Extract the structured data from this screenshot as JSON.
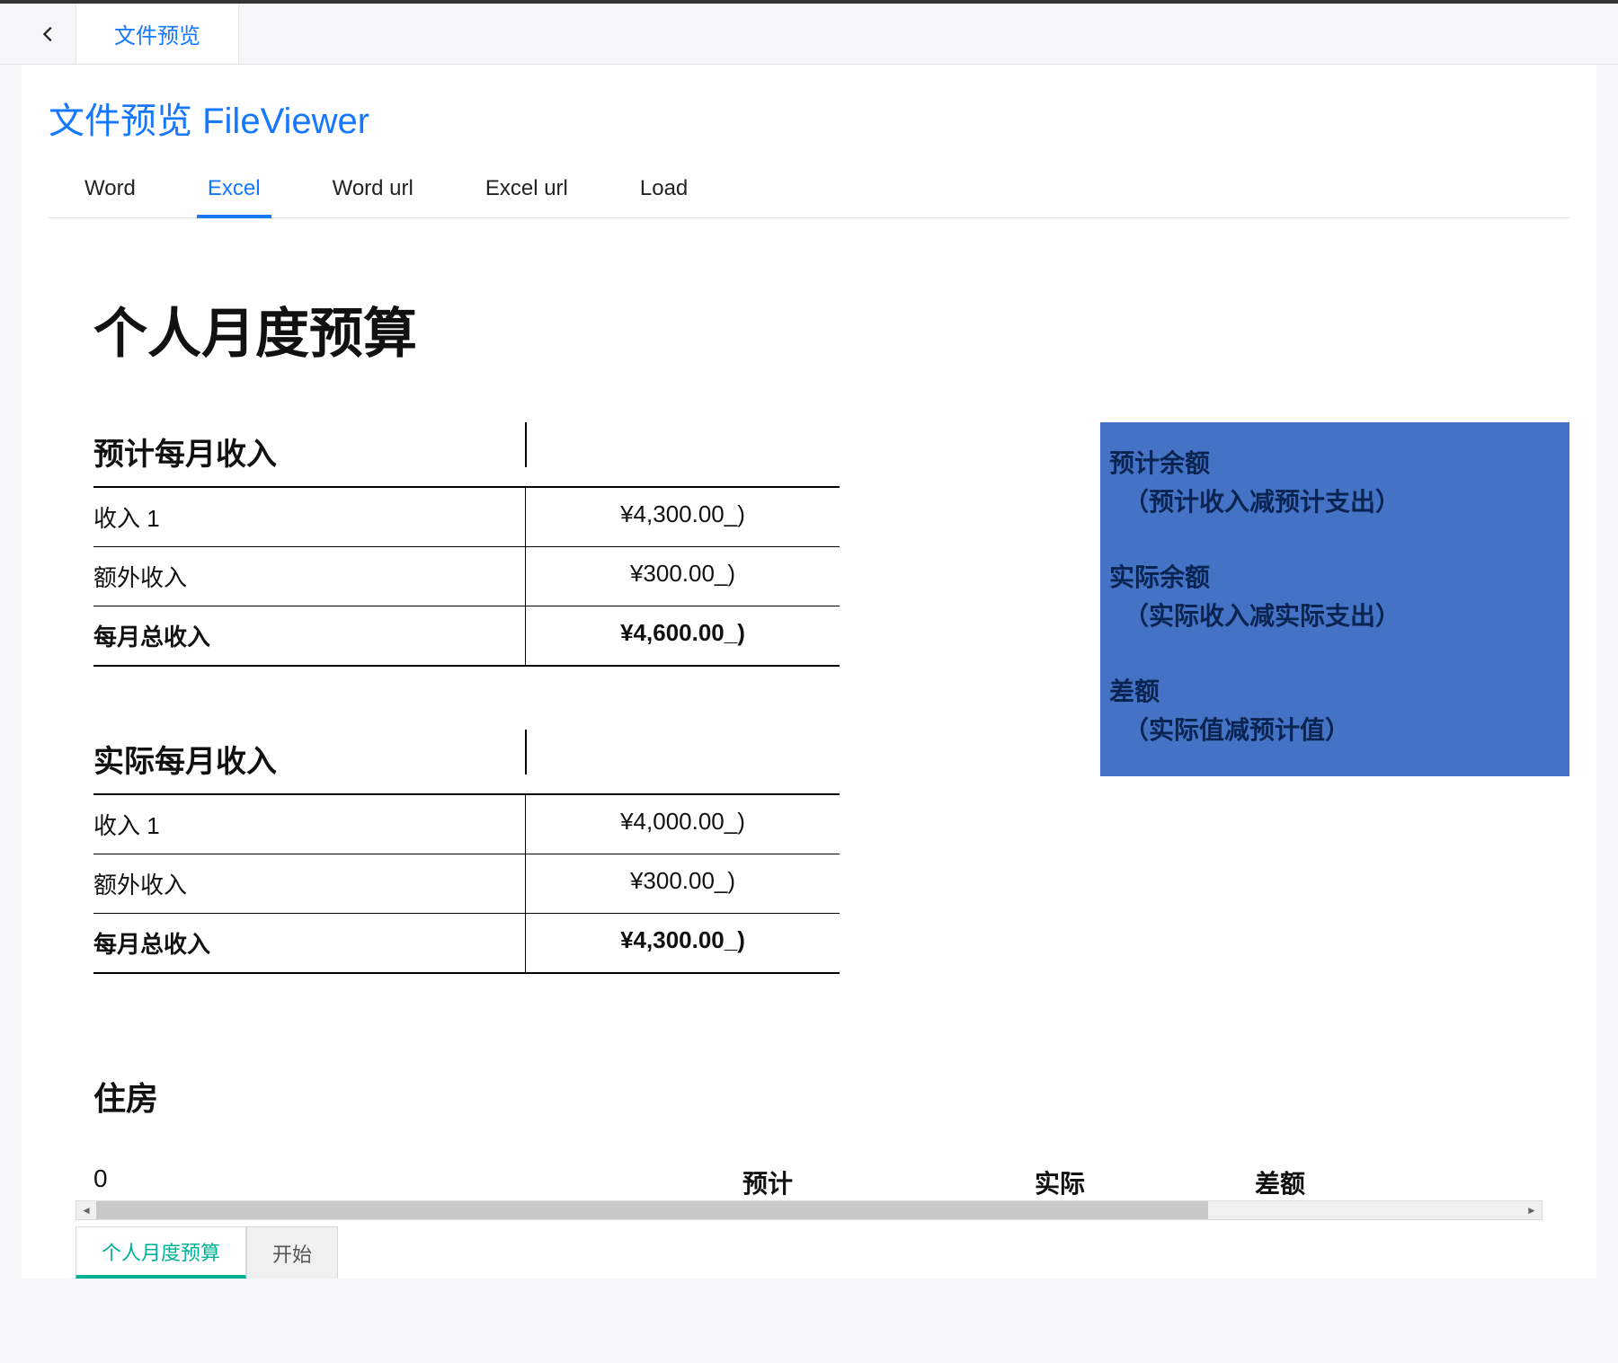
{
  "topbar": {
    "tab_label": "文件预览"
  },
  "page": {
    "title": "文件预览 FileViewer"
  },
  "subtabs": {
    "items": [
      {
        "label": "Word",
        "active": false
      },
      {
        "label": "Excel",
        "active": true
      },
      {
        "label": "Word url",
        "active": false
      },
      {
        "label": "Excel url",
        "active": false
      },
      {
        "label": "Load",
        "active": false
      }
    ]
  },
  "doc": {
    "title": "个人月度预算",
    "projected_income": {
      "heading": "预计每月收入",
      "rows": [
        {
          "label": "收入 1",
          "value": "¥4,300.00_)"
        },
        {
          "label": "额外收入",
          "value": "¥300.00_)"
        }
      ],
      "total_label": "每月总收入",
      "total_value": "¥4,600.00_)"
    },
    "actual_income": {
      "heading": "实际每月收入",
      "rows": [
        {
          "label": "收入 1",
          "value": "¥4,000.00_)"
        },
        {
          "label": "额外收入",
          "value": "¥300.00_)"
        }
      ],
      "total_label": "每月总收入",
      "total_value": "¥4,300.00_)"
    },
    "summary": {
      "items": [
        {
          "title": "预计余额",
          "sub": "（预计收入减预计支出）"
        },
        {
          "title": "实际余额",
          "sub": "（实际收入减实际支出）"
        },
        {
          "title": "差额",
          "sub": "（实际值减预计值）"
        }
      ]
    },
    "housing": {
      "heading": "住房",
      "row0": "0",
      "cols": [
        "预计",
        "实际",
        "差额"
      ]
    }
  },
  "sheets": {
    "items": [
      {
        "label": "个人月度预算",
        "active": true
      },
      {
        "label": "开始",
        "active": false
      }
    ]
  }
}
